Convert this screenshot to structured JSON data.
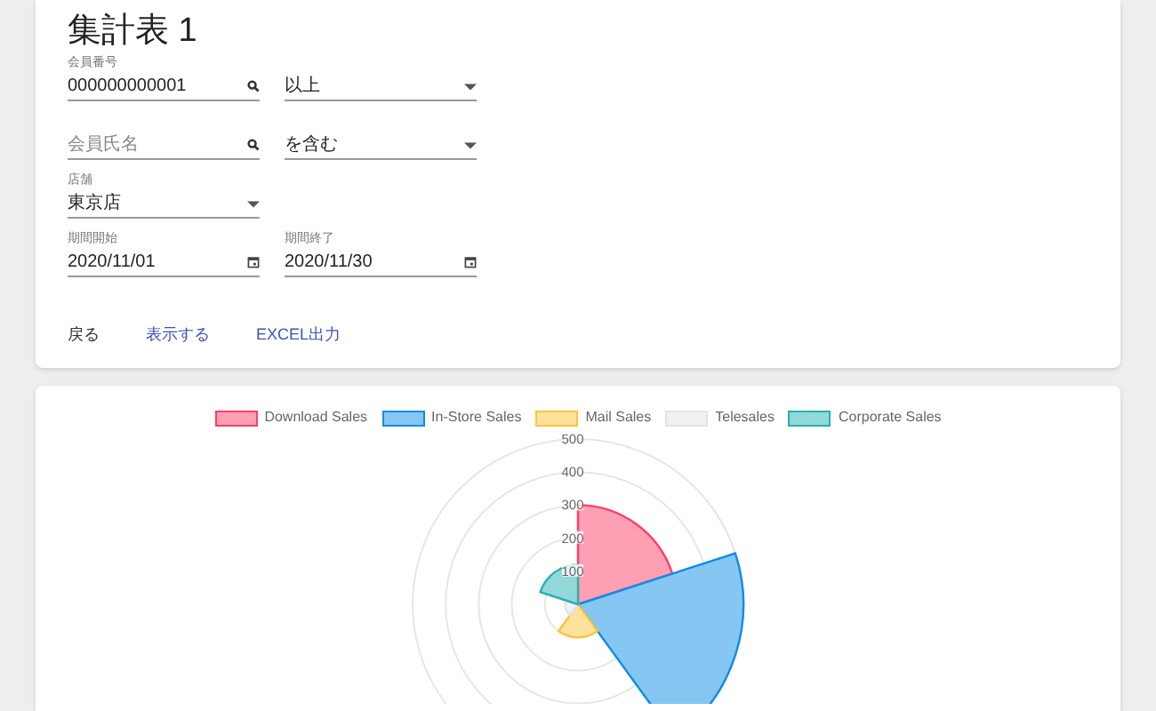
{
  "title": "集計表 1",
  "fields": [
    {
      "kind": "search",
      "label": "会員番号",
      "value": "000000000001"
    },
    {
      "kind": "select",
      "value": "以上"
    },
    {
      "kind": "search",
      "placeholder": "会員氏名"
    },
    {
      "kind": "select",
      "value": "を含む"
    },
    {
      "kind": "select",
      "label": "店舗",
      "value": "東京店"
    },
    {
      "kind": "date",
      "label": "期間開始",
      "value": "2020/11/01"
    },
    {
      "kind": "date",
      "label": "期間終了",
      "value": "2020/11/30"
    }
  ],
  "buttons": [
    {
      "label": "戻る",
      "kind": "plain"
    },
    {
      "label": "表示する",
      "kind": "link"
    },
    {
      "label": "EXCEL出力",
      "kind": "link"
    }
  ],
  "chart": {
    "legend": [
      {
        "label": "Download Sales",
        "color": "#ff9fb3"
      },
      {
        "label": "In-Store Sales",
        "color": "#86c6f3"
      },
      {
        "label": "Mail Sales",
        "color": "#ffe29c"
      },
      {
        "label": "Telesales",
        "color": "#f1f1f3"
      },
      {
        "label": "Corporate Sales",
        "color": "#92d8d8"
      }
    ],
    "scale_labels": [
      "500",
      "400",
      "300",
      "200",
      "100"
    ]
  }
}
